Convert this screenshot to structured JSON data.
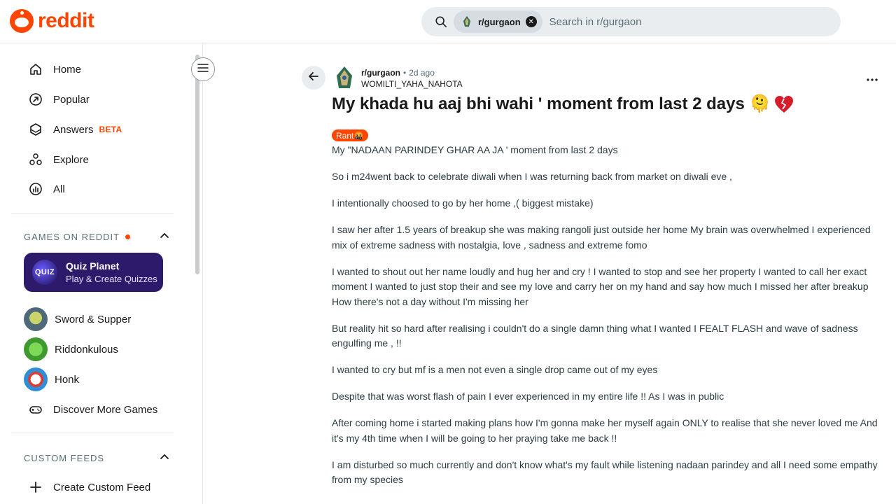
{
  "brand": {
    "logo_text": "reddit",
    "accent": "#ff4500"
  },
  "search": {
    "chip_label": "r/gurgaon",
    "placeholder": "Search in r/gurgaon",
    "value": ""
  },
  "sidebar": {
    "nav": [
      {
        "label": "Home",
        "icon": "home-icon"
      },
      {
        "label": "Popular",
        "icon": "popular-icon"
      },
      {
        "label": "Answers",
        "icon": "answers-icon",
        "badge": "BETA"
      },
      {
        "label": "Explore",
        "icon": "explore-icon"
      },
      {
        "label": "All",
        "icon": "all-icon"
      }
    ],
    "games_heading": "GAMES ON REDDIT",
    "featured_game": {
      "title": "Quiz Planet",
      "subtitle": "Play & Create Quizzes",
      "badge": "QUIZ"
    },
    "games": [
      {
        "label": "Sword & Supper"
      },
      {
        "label": "Riddonkulous"
      },
      {
        "label": "Honk"
      },
      {
        "label": "Discover More Games"
      }
    ],
    "custom_feeds_heading": "CUSTOM FEEDS",
    "create_feed_label": "Create Custom Feed"
  },
  "post": {
    "subreddit": "r/gurgaon",
    "separator": "•",
    "time_ago": "2d ago",
    "author": "WOMILTI_YAHA_NAHOTA",
    "title": "My khada hu aaj bhi wahi ' moment from last 2 days 🫠",
    "flair": "Rant🤬",
    "paragraphs": [
      "My \"NADAAN PARINDEY GHAR AA JA ' moment from last 2 days",
      "So i m24went back to celebrate diwali when I was returning back from market on diwali eve ,",
      "I intentionally choosed to go by her home ,( biggest mistake)",
      "I saw her after 1.5 years of breakup she was making rangoli just outside her home My brain was overwhelmed I experienced mix of extreme sadness with nostalgia, love , sadness and extreme fomo",
      "I wanted to shout out her name loudly and hug her and cry ! I wanted to stop and see her property I wanted to call her exact moment I wanted to just stop their and see my love and carry her on my hand and say how much I missed her after breakup How there's not a day without I'm missing her",
      "But reality hit so hard after realising i couldn't do a single damn thing what I wanted I FEALT FLASH and wave of sadness engulfing me , !!",
      "I wanted to cry but mf is a men not even a single drop came out of my eyes",
      "Despite that was worst flash of pain I ever experienced in my entire life !! As I was in public",
      "After coming home i started making plans how I'm gonna make her myself again ONLY to realise that she never loved me And it's my 4th time when I will be going to her praying take me back !!",
      "I am disturbed so much currently and don't know what's my fault while listening nadaan parindey and all I need some empathy from my species"
    ]
  }
}
